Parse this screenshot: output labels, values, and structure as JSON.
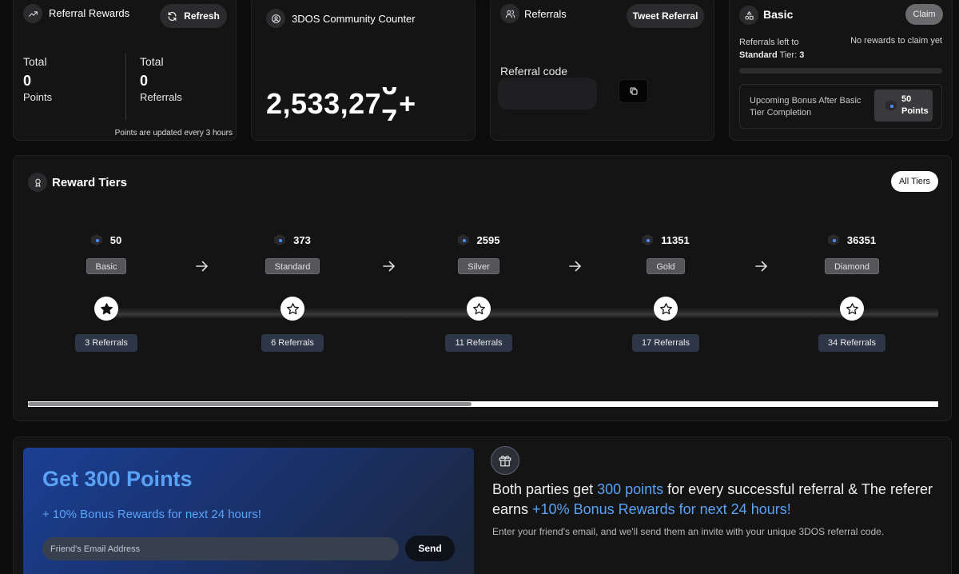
{
  "referral_rewards": {
    "title": "Referral Rewards",
    "refresh_label": "Refresh",
    "points": {
      "label": "Total",
      "value": "0",
      "unit": "Points"
    },
    "referrals": {
      "label": "Total",
      "value": "0",
      "unit": "Referrals"
    },
    "note": "Points are updated every 3 hours"
  },
  "community_counter": {
    "title": "3DOS Community Counter",
    "value_main": "2,533,27",
    "rolling_digit_top": "6",
    "rolling_digit_bottom": "7",
    "suffix": "+"
  },
  "referrals_card": {
    "title": "Referrals",
    "tweet_label": "Tweet Referral",
    "code_label": "Referral code"
  },
  "tier_card": {
    "title": "Basic",
    "claim_label": "Claim",
    "left_line1": "Referrals left to",
    "next_tier": "Standard",
    "tier_word": " Tier: ",
    "referrals_left": "3",
    "no_rewards": "No rewards to claim yet",
    "progress": 0,
    "bonus_text": "Upcoming Bonus After Basic Tier Completion",
    "bonus_value": "50",
    "bonus_unit": "Points"
  },
  "reward_tiers": {
    "title": "Reward Tiers",
    "all_tiers_label": "All Tiers",
    "tiers": [
      {
        "points": "50",
        "name": "Basic",
        "referrals": "3 Referrals",
        "achieved": true
      },
      {
        "points": "373",
        "name": "Standard",
        "referrals": "6 Referrals",
        "achieved": false
      },
      {
        "points": "2595",
        "name": "Silver",
        "referrals": "11 Referrals",
        "achieved": false
      },
      {
        "points": "11351",
        "name": "Gold",
        "referrals": "17 Referrals",
        "achieved": false
      },
      {
        "points": "36351",
        "name": "Diamond",
        "referrals": "34 Referrals",
        "achieved": false
      }
    ]
  },
  "invite": {
    "headline": "Get 300 Points",
    "bonus": "+ 10% Bonus Rewards for next 24 hours!",
    "email_placeholder": "Friend's Email Address",
    "send_label": "Send",
    "explain_a": "Both parties get ",
    "explain_hl1": "300 points",
    "explain_b": " for every successful referral & The referer earns ",
    "explain_hl2": "+10% Bonus Rewards for next 24 hours!",
    "sub": "Enter your friend's email, and we'll send them an invite with your unique 3DOS referral code."
  },
  "colors": {
    "accent_blue": "#5aa2f5",
    "tier_badge": "#55555a",
    "referral_badge": "#2d3748"
  },
  "icons": [
    "trending-up-icon",
    "refresh-icon",
    "user-circle-icon",
    "users-icon",
    "copy-icon",
    "tier-shapes-icon",
    "award-icon",
    "star-icon",
    "arrow-right-icon",
    "gift-icon",
    "hex-token-icon"
  ]
}
